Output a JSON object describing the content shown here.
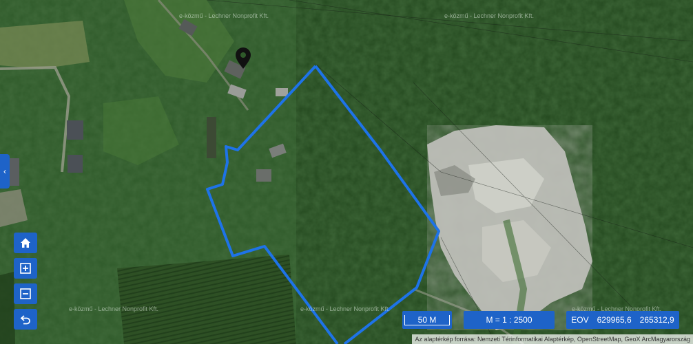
{
  "map": {
    "watermarks": [
      "e-közmű - Lechner Nonprofit Kft.",
      "e-közmű - Lechner Nonprofit Kft.",
      "e-közmű - Lechner Nonprofit Kft.",
      "e-közmű - Lechner Nonprofit Kft.",
      "e-közmű - Lechner Nonprofit Kft."
    ],
    "marker_icon": "map-pin-icon",
    "parcel_outline_color": "#1e73e8"
  },
  "controls": {
    "side_toggle": "‹",
    "home_icon": "home-icon",
    "zoom_in_icon": "zoom-in-icon",
    "zoom_out_icon": "zoom-out-icon",
    "back_icon": "back-icon"
  },
  "status": {
    "scale_bar": "50 M",
    "map_scale": "M = 1 : 2500",
    "eov_label": "EOV",
    "eov_x": "629965,6",
    "eov_y": "265312,9"
  },
  "attribution": "Az alaptérkép forrása: Nemzeti Térinformatikai Alaptérkép, OpenStreetMap, GeoX ArcMagyarország"
}
